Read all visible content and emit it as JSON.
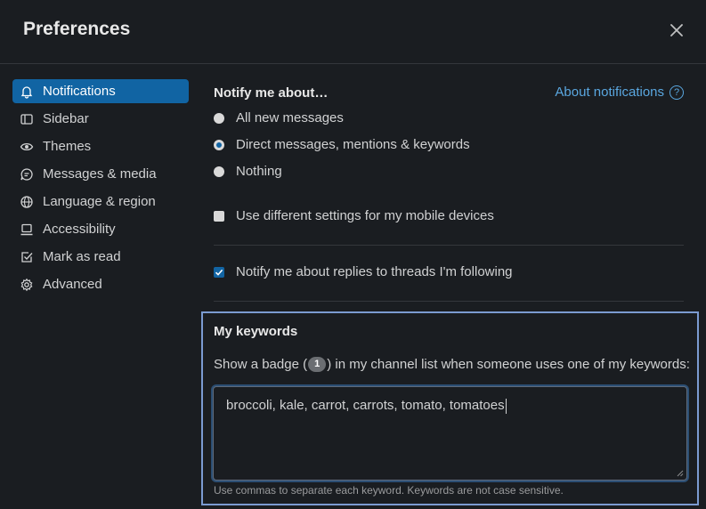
{
  "header": {
    "title": "Preferences"
  },
  "sidebar": {
    "items": [
      {
        "label": "Notifications",
        "icon": "bell-icon",
        "active": true
      },
      {
        "label": "Sidebar",
        "icon": "sidebar-icon"
      },
      {
        "label": "Themes",
        "icon": "eye-icon"
      },
      {
        "label": "Messages & media",
        "icon": "message-icon"
      },
      {
        "label": "Language & region",
        "icon": "globe-icon"
      },
      {
        "label": "Accessibility",
        "icon": "laptop-icon"
      },
      {
        "label": "Mark as read",
        "icon": "check-square-icon"
      },
      {
        "label": "Advanced",
        "icon": "gear-icon"
      }
    ]
  },
  "main": {
    "notify_title": "Notify me about…",
    "about_link": "About notifications",
    "notify_options": [
      {
        "label": "All new messages",
        "checked": false
      },
      {
        "label": "Direct messages, mentions & keywords",
        "checked": true
      },
      {
        "label": "Nothing",
        "checked": false
      }
    ],
    "mobile_label": "Use different settings for my mobile devices",
    "mobile_checked": false,
    "threads_label": "Notify me about replies to threads I'm following",
    "threads_checked": true
  },
  "keywords": {
    "title": "My keywords",
    "desc_before": "Show a badge (",
    "badge": "1",
    "desc_after": ") in my channel list when someone uses one of my keywords:",
    "value": "broccoli, kale, carrot, carrots, tomato, tomatoes",
    "hint": "Use commas to separate each keyword. Keywords are not case sensitive."
  },
  "colors": {
    "accent": "#1164a3",
    "background": "#1a1d21",
    "link": "#5aa7e0",
    "focus_border": "#7b9bd1"
  }
}
